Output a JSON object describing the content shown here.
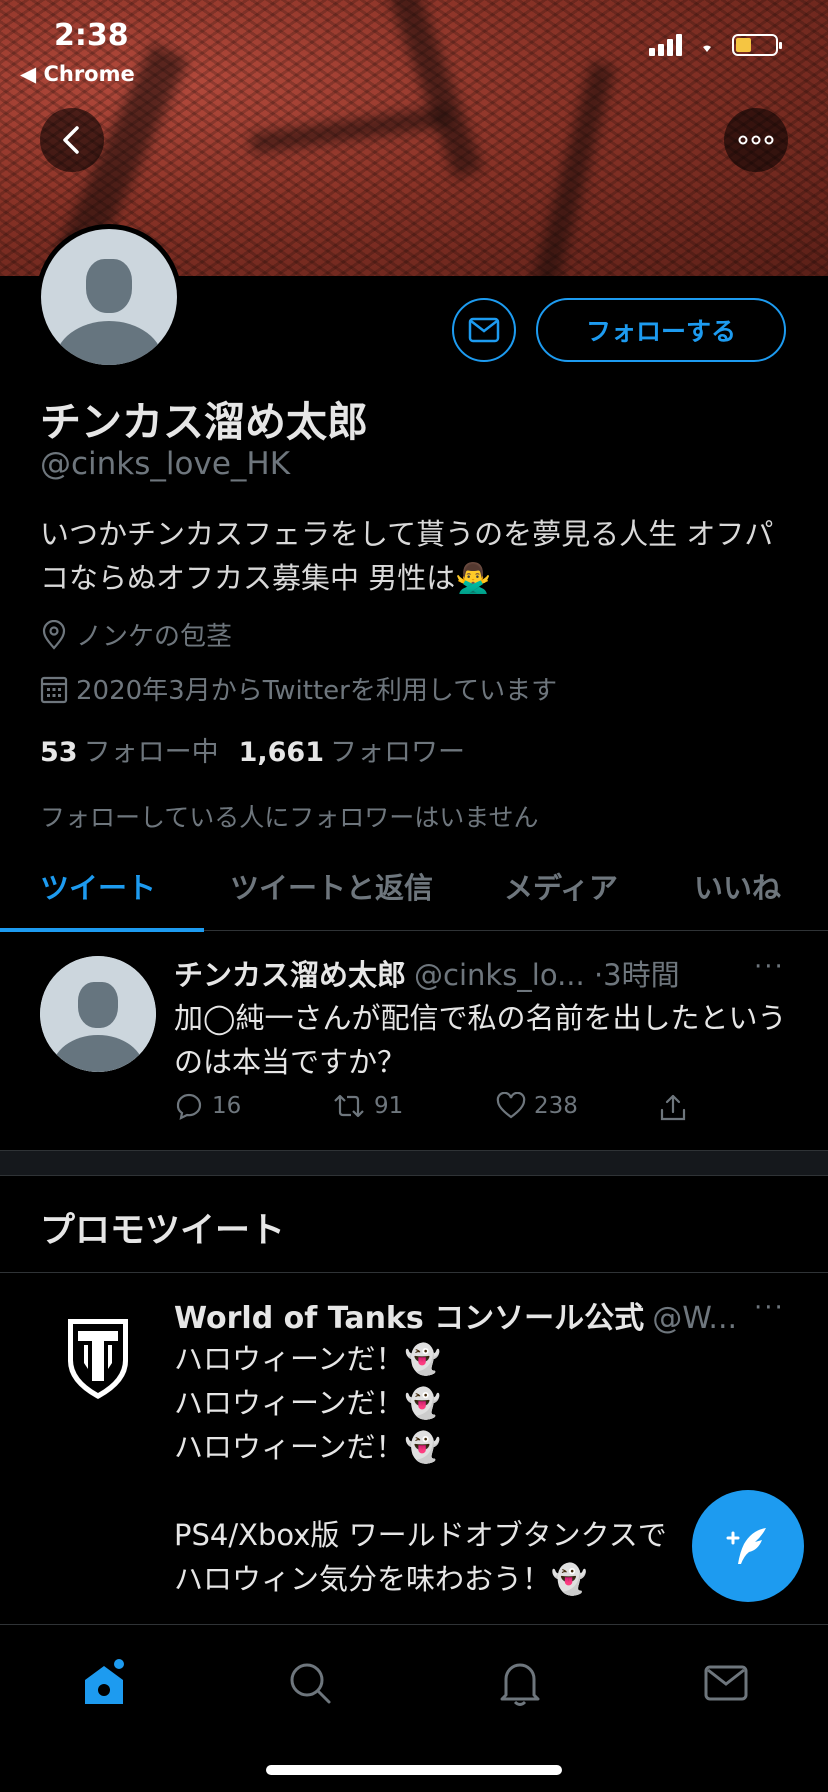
{
  "status_bar": {
    "time": "2:38",
    "back_app": "◀ Chrome"
  },
  "profile": {
    "display_name": "チンカス溜め太郎",
    "handle": "@cinks_love_HK",
    "bio": "いつかチンカスフェラをして貰うのを夢見る人生 オフパコならぬオフカス募集中 男性は🙅‍♂️",
    "location": "ノンケの包茎",
    "joined": "2020年3月からTwitterを利用しています",
    "following_count": "53",
    "following_label": "フォロー中",
    "followers_count": "1,661",
    "followers_label": "フォロワー",
    "no_mutual_followers": "フォローしている人にフォロワーはいません",
    "follow_button": "フォローする"
  },
  "tabs": [
    {
      "label": "ツイート",
      "active": true
    },
    {
      "label": "ツイートと返信",
      "active": false
    },
    {
      "label": "メディア",
      "active": false
    },
    {
      "label": "いいね",
      "active": false
    }
  ],
  "tweet": {
    "name": "チンカス溜め太郎",
    "handle": "@cinks_lo...",
    "time": "·3時間",
    "text": "加◯純一さんが配信で私の名前を出したというのは本当ですか？",
    "replies": "16",
    "retweets": "91",
    "likes": "238"
  },
  "promo": {
    "section_title": "プロモツイート",
    "name": "World of Tanks コンソール公式",
    "handle": "@W...",
    "lines": [
      "ハロウィーンだ！👻",
      "ハロウィーンだ！👻",
      "ハロウィーンだ！👻",
      "",
      "PS4/Xbox版 ワールドオブタンクスで",
      "ハロウィン気分を味わおう！👻"
    ]
  },
  "colors": {
    "accent": "#1d9bf0",
    "background": "#000000",
    "muted_text": "#6e767d"
  },
  "icons": {
    "back": "chevron-left-icon",
    "more": "more-horizontal-icon",
    "message": "envelope-icon",
    "location": "location-pin-icon",
    "calendar": "calendar-icon",
    "reply": "reply-icon",
    "retweet": "retweet-icon",
    "like": "heart-icon",
    "share": "share-icon",
    "compose": "compose-tweet-icon",
    "home": "home-icon",
    "search": "search-icon",
    "notifications": "bell-icon",
    "messages": "envelope-icon"
  }
}
